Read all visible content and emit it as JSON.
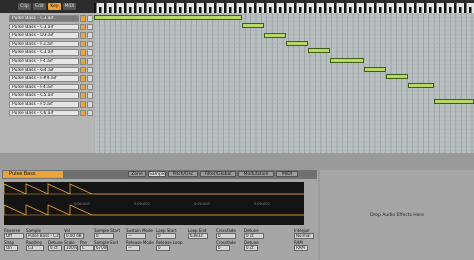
{
  "toolbar": {
    "modes": [
      {
        "label": "Clip",
        "active": false
      },
      {
        "label": "Edit",
        "active": false
      },
      {
        "label": "Key",
        "active": true
      },
      {
        "label": "MIDI",
        "active": false
      }
    ]
  },
  "keys": [
    {
      "label": "Pulse Bass - C3.aif",
      "highlight": true
    },
    {
      "label": "Pulse Bass - C3.aif",
      "highlight": false
    },
    {
      "label": "Pulse Bass - D3.aif",
      "highlight": false
    },
    {
      "label": "Pulse Bass - F3.aif",
      "highlight": false
    },
    {
      "label": "Pulse Bass - C3.aif",
      "highlight": false
    },
    {
      "label": "Pulse Bass - F4.aif",
      "highlight": false
    },
    {
      "label": "Pulse Bass - G4.aif",
      "highlight": false
    },
    {
      "label": "Pulse Bass - F#4.aif",
      "highlight": false
    },
    {
      "label": "Pulse Bass - F4.aif",
      "highlight": false
    },
    {
      "label": "Pulse Bass - C5.aif",
      "highlight": false
    },
    {
      "label": "Pulse Bass - F5.aif",
      "highlight": false
    },
    {
      "label": "Pulse Bass - C6.aif",
      "highlight": false
    }
  ],
  "device": {
    "title": "Pulse Bass",
    "tabs": [
      "Zone",
      "Sample",
      "Pitch/Osc",
      "Filter/Global",
      "Modulation",
      "MIDI"
    ],
    "active_tab": "Sample",
    "wave_ticks": [
      "0:00:000",
      "0:00:000",
      "0:00:000",
      "0:00:000"
    ],
    "controls": [
      {
        "label": "Reverse",
        "value": "Off"
      },
      {
        "label": "Sample",
        "value": "Pulse Bass - C3.aif"
      },
      {
        "label": "Vol",
        "value": "0.00 dB"
      },
      {
        "label": "Sample Start",
        "value": "0"
      },
      {
        "label": "Sustain Mode",
        "value": "—"
      },
      {
        "label": "Loop Start",
        "value": "0"
      },
      {
        "label": "Loop End",
        "value": "63833"
      },
      {
        "label": "Crossfade",
        "value": "0"
      },
      {
        "label": "Detune",
        "value": "0 ct"
      },
      {
        "label": "Interpol",
        "value": "Normal"
      }
    ],
    "controls_row2": [
      {
        "label": "Snap",
        "value": "On"
      },
      {
        "label": "Rootkey",
        "value": "C3"
      },
      {
        "label": "Detune",
        "value": "0 ct"
      },
      {
        "label": "Scale",
        "value": "100%"
      },
      {
        "label": "Pan",
        "value": "C"
      },
      {
        "label": "Sample End",
        "value": "67000"
      },
      {
        "label": "Release Mode",
        "value": "—"
      },
      {
        "label": "Release Loop",
        "value": "0"
      },
      {
        "label": "Crossfade",
        "value": "0"
      },
      {
        "label": "Detune",
        "value": "0 ct"
      },
      {
        "label": "RAM",
        "value": "RAM"
      }
    ]
  },
  "fx": {
    "drop_text": "Drop Audio Effects Here"
  },
  "colors": {
    "accent": "#e8a33b",
    "note": "#b4d86a",
    "note_border": "#3f5e14",
    "wave": "#e8a33b"
  }
}
